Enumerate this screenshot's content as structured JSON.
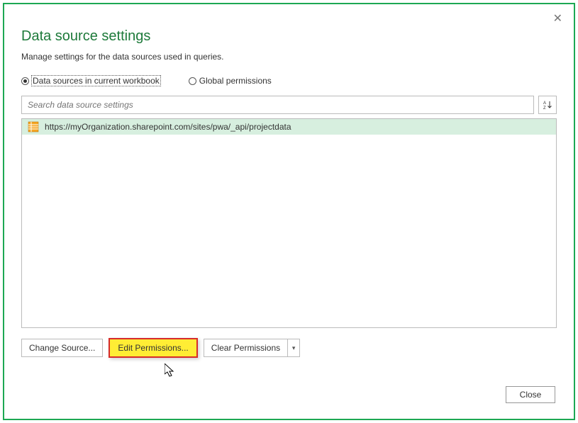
{
  "dialog": {
    "title": "Data source settings",
    "subtitle": "Manage settings for the data sources used in queries."
  },
  "radios": {
    "current_workbook": "Data sources in current workbook",
    "global": "Global permissions",
    "selected": "current_workbook"
  },
  "search": {
    "placeholder": "Search data source settings"
  },
  "list": {
    "items": [
      {
        "url": "https://myOrganization.sharepoint.com/sites/pwa/_api/projectdata"
      }
    ]
  },
  "buttons": {
    "change_source": "Change Source...",
    "edit_permissions": "Edit Permissions...",
    "clear_permissions": "Clear Permissions",
    "close": "Close"
  },
  "icons": {
    "sort": "A↓",
    "dropdown": "▾"
  }
}
